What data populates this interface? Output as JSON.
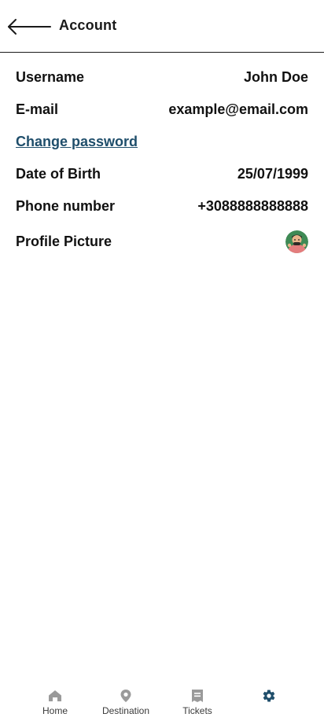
{
  "header": {
    "title": "Account"
  },
  "account": {
    "username_label": "Username",
    "username_value": "John Doe",
    "email_label": "E-mail",
    "email_value": "example@email.com",
    "change_password_label": "Change password",
    "dob_label": "Date of Birth",
    "dob_value": "25/07/1999",
    "phone_label": "Phone number",
    "phone_value": "+3088888888888",
    "picture_label": "Profile Picture"
  },
  "bottom_nav": {
    "items": [
      {
        "label": "Home",
        "icon": "home-icon"
      },
      {
        "label": "Destination",
        "icon": "location-pin-icon"
      },
      {
        "label": "Tickets",
        "icon": "ticket-icon"
      },
      {
        "label": "",
        "icon": "gear-icon",
        "active": true
      }
    ]
  },
  "colors": {
    "link": "#1f4e6b",
    "nav_icon": "#9a9a9a",
    "nav_active": "#1f4e6b",
    "divider": "#1a1a1a"
  }
}
